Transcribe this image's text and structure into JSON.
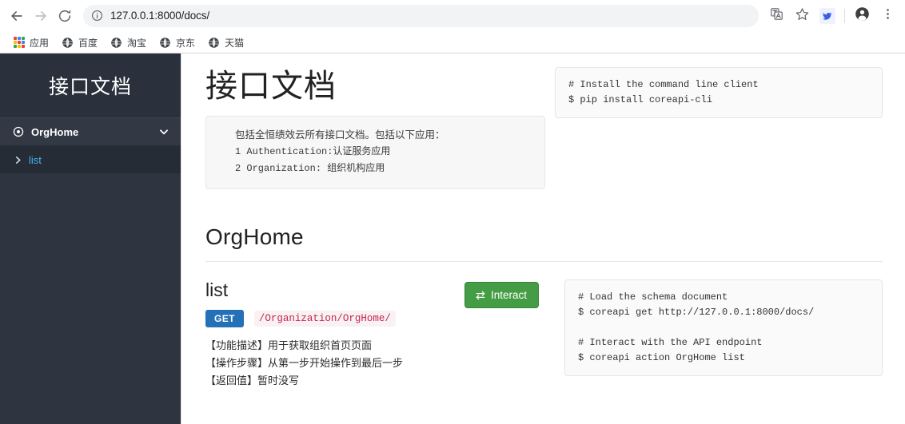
{
  "browser": {
    "back_tooltip": "Back",
    "forward_tooltip": "Forward",
    "reload_tooltip": "Reload",
    "url": "127.0.0.1:8000/docs/",
    "site_info_icon": "info-circle-icon",
    "translate_icon": "translate-icon",
    "bookmark_icon": "star-icon",
    "extension_icon": "extension-bird-icon",
    "profile_icon": "account-avatar-icon",
    "menu_icon": "three-dot-menu-icon",
    "bookmarks": [
      {
        "label": "应用",
        "icon": "apps-grid-icon"
      },
      {
        "label": "百度",
        "icon": "globe-icon"
      },
      {
        "label": "淘宝",
        "icon": "globe-icon"
      },
      {
        "label": "京东",
        "icon": "globe-icon"
      },
      {
        "label": "天猫",
        "icon": "globe-icon"
      }
    ]
  },
  "sidebar": {
    "brand": "接口文档",
    "items": [
      {
        "label": "OrgHome",
        "icon": "target-dot-icon",
        "chevron": "chevron-down-icon"
      }
    ],
    "sub_items": [
      {
        "label": "list",
        "icon": "chevron-right-icon"
      }
    ]
  },
  "main": {
    "title": "接口文档",
    "description_lines": [
      "包括全恒绩效云所有接口文档。包括以下应用：",
      "1 Authentication:认证服务应用",
      "2 Organization: 组织机构应用"
    ],
    "install_code": "# Install the command line client\n$ pip install coreapi-cli",
    "section": {
      "title": "OrgHome",
      "link": {
        "title": "list",
        "method": "GET",
        "path": "/Organization/OrgHome/",
        "description_lines": [
          "【功能描述】用于获取组织首页页面",
          "【操作步骤】从第一步开始操作到最后一步",
          "【返回值】暂时没写"
        ],
        "interact_label": "Interact",
        "interact_icon": "exchange-arrows-icon",
        "code": "# Load the schema document\n$ coreapi get http://127.0.0.1:8000/docs/\n\n# Interact with the API endpoint\n$ coreapi action OrgHome list"
      }
    }
  },
  "colors": {
    "sidebar_bg": "#2e3440",
    "sidebar_item_bg": "#323844",
    "sidebar_sub_bg": "#262c35",
    "sidebar_link": "#41b3e8",
    "get_badge": "#2471b8",
    "interact_button": "#449d44",
    "code_path": "#c7254e"
  }
}
